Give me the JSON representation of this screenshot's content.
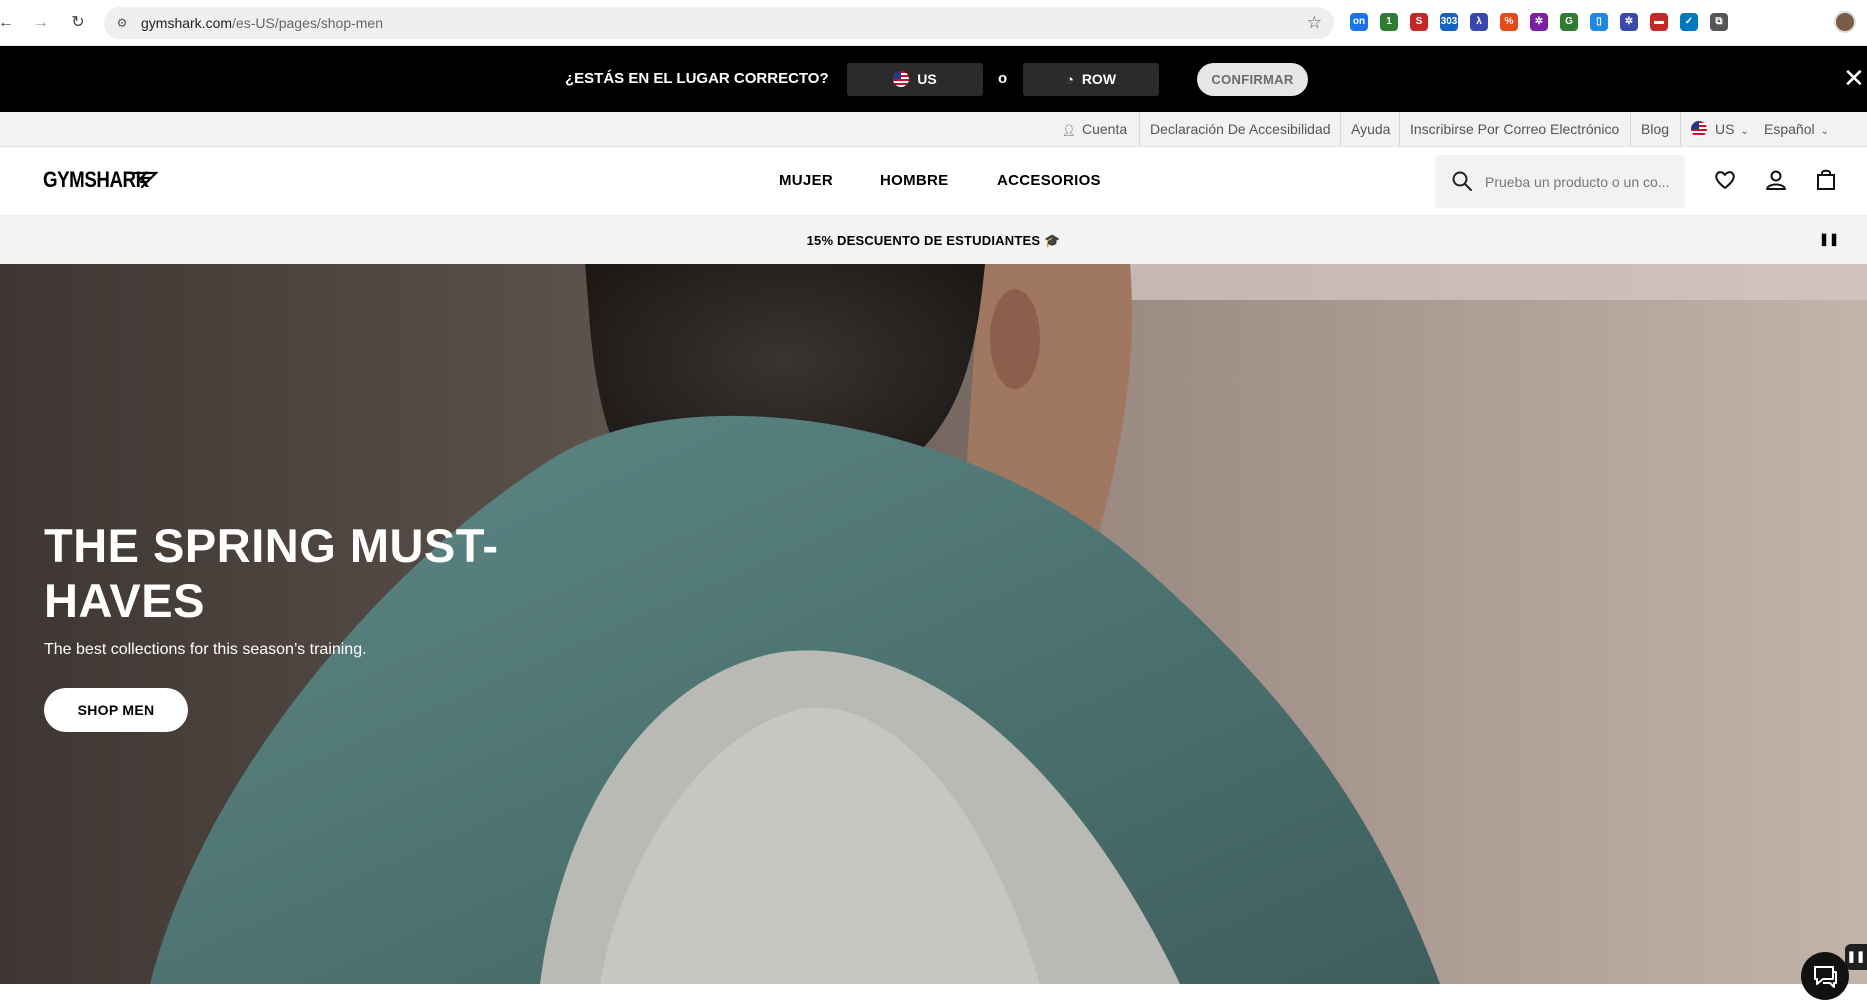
{
  "browser": {
    "url_host": "gymshark.com",
    "url_path": "/es-US/pages/shop-men",
    "back_icon": "arrow-left-icon",
    "forward_icon": "arrow-right-icon",
    "reload_icon": "reload-icon",
    "bookmark_icon": "star-icon",
    "extensions": [
      {
        "name": "on",
        "color": "#1a73e8"
      },
      {
        "name": "1",
        "color": "#2e7d32"
      },
      {
        "name": "S",
        "color": "#c62828"
      },
      {
        "name": "303",
        "color": "#1565c0"
      },
      {
        "name": "λ",
        "color": "#3949ab"
      },
      {
        "name": "%",
        "color": "#e64a19"
      },
      {
        "name": "✲",
        "color": "#7b1fa2"
      },
      {
        "name": "G",
        "color": "#2e7d32"
      },
      {
        "name": "▯",
        "color": "#1e88e5"
      },
      {
        "name": "✲",
        "color": "#3949ab"
      },
      {
        "name": "▬",
        "color": "#c62828"
      },
      {
        "name": "✓",
        "color": "#0277bd"
      },
      {
        "name": "⧉",
        "color": "#555555"
      }
    ]
  },
  "region_banner": {
    "question": "¿ESTÁS EN EL LUGAR CORRECTO?",
    "option_us": "US",
    "or_text": "o",
    "option_row": "ROW",
    "confirm": "CONFIRMAR",
    "close_icon": "close-icon"
  },
  "utility_bar": {
    "account": "Cuenta",
    "accessibility": "Declaración De Accesibilidad",
    "help": "Ayuda",
    "email_signup": "Inscribirse Por Correo Electrónico",
    "blog": "Blog",
    "country": "US",
    "language": "Español"
  },
  "header": {
    "logo": "GYMSHARK",
    "nav": [
      "MUJER",
      "HOMBRE",
      "ACCESORIOS"
    ],
    "search_placeholder": "Prueba un producto o un co...",
    "icons": [
      "heart-icon",
      "user-icon",
      "bag-icon"
    ]
  },
  "promo": {
    "text": "15% DESCUENTO DE ESTUDIANTES 🎓",
    "pause_icon": "pause-icon"
  },
  "hero": {
    "title": "THE SPRING MUST-HAVES",
    "subtitle": "The best collections for this season’s training.",
    "cta": "SHOP MEN",
    "pause_icon": "pause-icon",
    "chat_icon": "chat-icon"
  }
}
